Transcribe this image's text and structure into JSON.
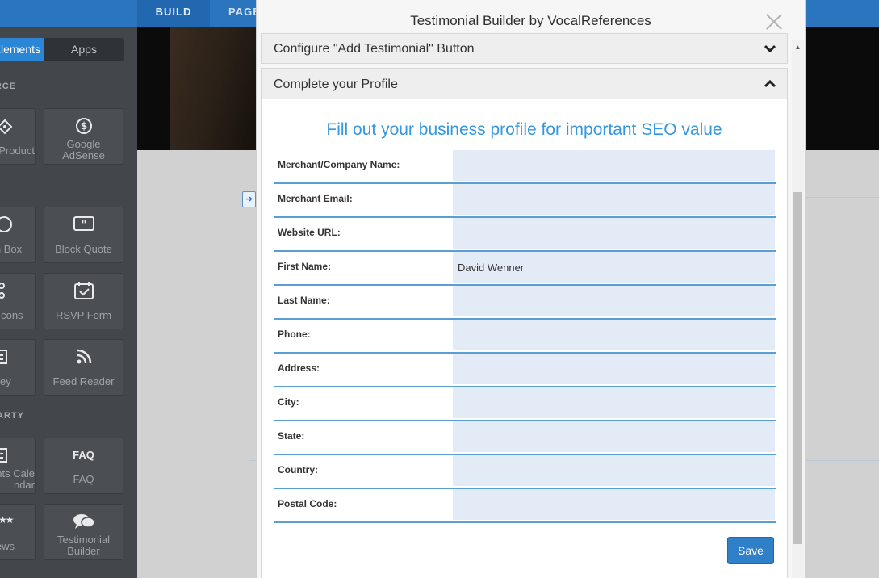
{
  "topbar": {
    "tabs": [
      {
        "label": "BUILD",
        "active": true
      },
      {
        "label": "PAGES",
        "active": false
      }
    ]
  },
  "sidebar": {
    "segment": {
      "elements_label": "Elements",
      "apps_label": "Apps"
    },
    "sections": {
      "commerce": "COMMERCE",
      "third_party": "THIRD PARTY"
    },
    "tiles": {
      "product": "Product",
      "google_adsense": "Google AdSense",
      "search_box": "Search Box",
      "block_quote": "Block Quote",
      "social_icons": "Social Icons",
      "rsvp_form": "RSVP Form",
      "survey": "Survey",
      "feed_reader": "Feed Reader",
      "events_calendar": "Events Calendar",
      "faq_icon_text": "FAQ",
      "faq": "FAQ",
      "reviews": "Reviews",
      "testimonial_builder": "Testimonial Builder"
    }
  },
  "modal": {
    "title": "Testimonial Builder by VocalReferences",
    "accordion": [
      {
        "label": "Configure \"Add Testimonial\" Button",
        "expanded": false
      },
      {
        "label": "Complete your Profile",
        "expanded": true
      }
    ],
    "heading": "Fill out your business profile for important SEO value",
    "fields": [
      {
        "label": "Merchant/Company Name:",
        "value": ""
      },
      {
        "label": "Merchant Email:",
        "value": ""
      },
      {
        "label": "Website URL:",
        "value": ""
      },
      {
        "label": "First Name:",
        "value": "David Wenner"
      },
      {
        "label": "Last Name:",
        "value": ""
      },
      {
        "label": "Phone:",
        "value": ""
      },
      {
        "label": "Address:",
        "value": ""
      },
      {
        "label": "City:",
        "value": ""
      },
      {
        "label": "State:",
        "value": ""
      },
      {
        "label": "Country:",
        "value": ""
      },
      {
        "label": "Postal Code:",
        "value": ""
      }
    ],
    "save_label": "Save"
  },
  "colors": {
    "topbar": "#2b74be",
    "sidebar": "#43474b",
    "accent_blue": "#3597dd",
    "input_bg": "#e3ecf6",
    "button_blue": "#2f7fc9"
  }
}
